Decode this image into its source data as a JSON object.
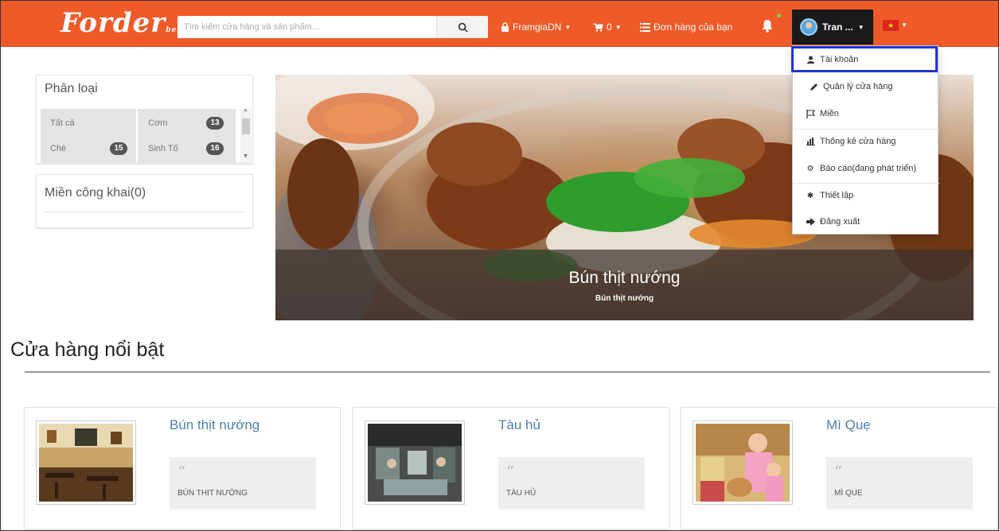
{
  "colors": {
    "brand": "#f05a28",
    "user_box": "#1a1a1a",
    "highlight": "#1f35d6",
    "link": "#4a7fb0"
  },
  "navbar": {
    "logo": "Forder",
    "logo_sub": "beta",
    "search_placeholder": "Tìm kiếm cửa hàng và sản phẩm...",
    "search_icon": "search-icon",
    "store_label": "FramgiaDN",
    "cart_label": "0",
    "orders_label": "Đơn hàng của bạn",
    "user_label": "Tran ...",
    "language": "vi"
  },
  "dropdown": {
    "items": [
      {
        "label": "Tài khoản",
        "icon": "user-icon"
      },
      {
        "label": "Quản lý cửa hàng",
        "icon": "pencil-icon"
      },
      {
        "label": "Miền",
        "icon": "flag-icon"
      },
      {
        "label": "Thống kê cửa hàng",
        "icon": "bar-chart-icon"
      },
      {
        "label": "Báo cáo(đang phát triển)",
        "icon": "gear-report-icon"
      },
      {
        "label": "Thiết lập",
        "icon": "settings-icon"
      },
      {
        "label": "Đăng xuất",
        "icon": "logout-icon"
      }
    ]
  },
  "sidebar": {
    "category_title": "Phân loại",
    "categories": [
      {
        "label": "Tất cả",
        "count": ""
      },
      {
        "label": "Cơm",
        "count": "13"
      },
      {
        "label": "Chè",
        "count": "15"
      },
      {
        "label": "Sinh Tố",
        "count": "16"
      }
    ],
    "domain_title": "Miền công khai(0)"
  },
  "hero": {
    "title": "Bún thịt nướng",
    "subtitle": "Bún thịt nướng"
  },
  "featured": {
    "title": "Cửa hàng nổi bật",
    "stores": [
      {
        "name": "Bún thịt nướng",
        "quote": "BÚN THỊT NƯỚNG"
      },
      {
        "name": "Tàu hủ",
        "quote": "TÀU HỦ"
      },
      {
        "name": "Mì Quẹ",
        "quote": "MÌ QUẸ"
      }
    ]
  }
}
